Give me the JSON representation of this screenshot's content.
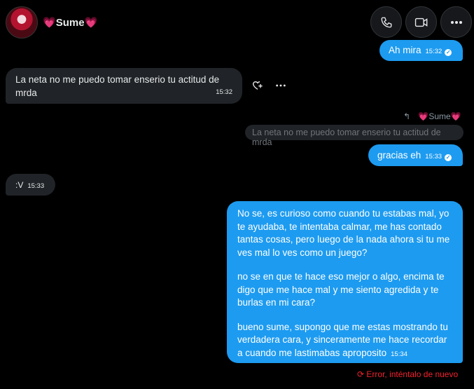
{
  "header": {
    "contact_name": "Sume",
    "heart_left": "💗",
    "heart_right": "💗"
  },
  "icons": {
    "call": "phone-icon",
    "video": "video-icon",
    "more": "more-horizontal-icon",
    "react": "heart-plus-icon",
    "options": "more-horizontal-icon",
    "reply": "reply-arrow-icon",
    "retry": "retry-icon"
  },
  "colors": {
    "sent_bubble": "#1d9bf0",
    "received_bubble": "#202327",
    "error": "#f4212e",
    "background": "#000000"
  },
  "messages": {
    "m1": {
      "text": "Ah mira",
      "time": "15:32"
    },
    "m2": {
      "text": "La neta no me puedo tomar enserio tu actitud de mrda",
      "time": "15:32"
    },
    "reply_to": {
      "author": "Sume",
      "quoted": "La neta no me puedo tomar enserio tu actitud de mrda"
    },
    "m3": {
      "text": "gracias eh",
      "time": "15:33"
    },
    "m4": {
      "text": ":V",
      "time": "15:33"
    },
    "m5": {
      "p1": "No se, es curioso como cuando tu estabas mal, yo te ayudaba, te intentaba calmar, me has contado tantas cosas, pero luego de la nada ahora si tu me ves mal lo ves como un juego?",
      "p2": "no se en que te hace eso mejor o algo, encima te digo que me hace mal y me siento agredida y te burlas en mi cara?",
      "p3": "bueno sume, supongo que me estas mostrando tu verdadera cara, y sinceramente me hace recordar a cuando me lastimabas aproposito",
      "time": "15:34"
    },
    "error_text": "Error, inténtalo de nuevo"
  }
}
